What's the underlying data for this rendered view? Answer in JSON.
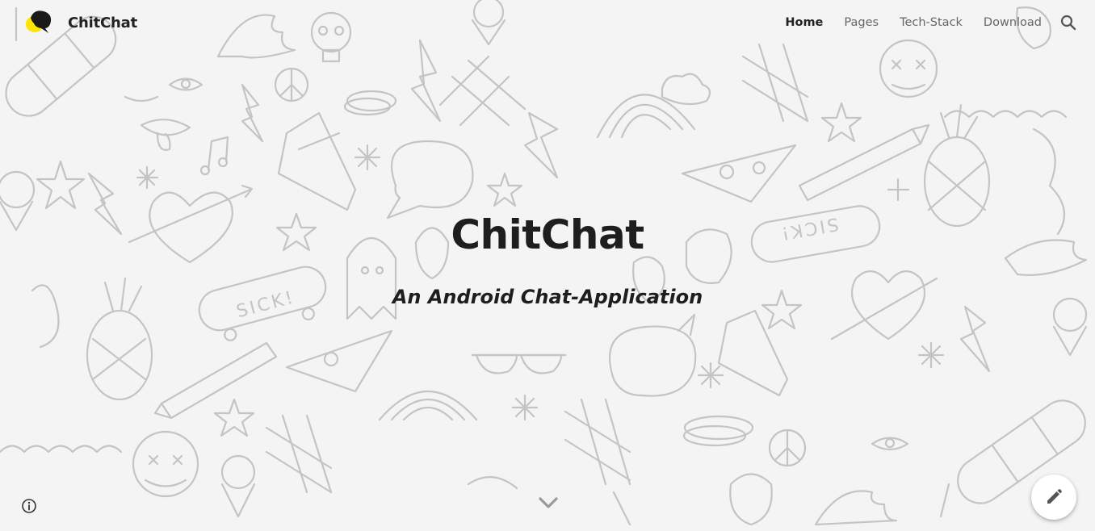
{
  "navbar": {
    "brand_name": "ChitChat",
    "links": [
      {
        "label": "Home",
        "active": true
      },
      {
        "label": "Pages",
        "active": false
      },
      {
        "label": "Tech-Stack",
        "active": false
      },
      {
        "label": "Download",
        "active": false
      }
    ],
    "search_icon": "search-icon"
  },
  "hero": {
    "title": "ChitChat",
    "subtitle": "An Android Chat-Application",
    "background_doodle_texts": [
      "SICK!",
      "SICK!"
    ]
  },
  "controls": {
    "scroll_icon": "chevron-down-icon",
    "info_icon": "info-icon",
    "edit_icon": "pencil-icon"
  },
  "colors": {
    "background": "#f4f4f4",
    "doodle_stroke": "#c4c4c4",
    "text_dark": "#1e1e1e",
    "nav_text": "#666666",
    "logo_yellow": "#ffe600"
  }
}
